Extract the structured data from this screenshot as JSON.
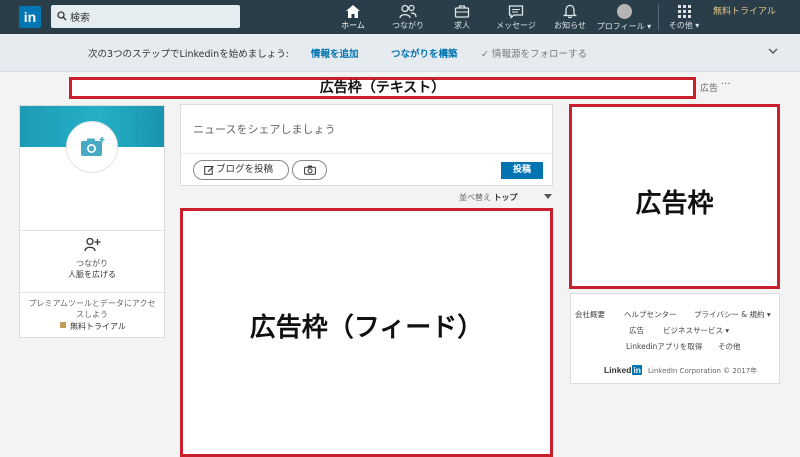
{
  "header": {
    "logo": "in",
    "search_placeholder": "検索",
    "nav": [
      {
        "label": "ホーム",
        "icon": "home-icon"
      },
      {
        "label": "つながり",
        "icon": "people-icon"
      },
      {
        "label": "求人",
        "icon": "briefcase-icon"
      },
      {
        "label": "メッセージ",
        "icon": "chat-icon"
      },
      {
        "label": "お知らせ",
        "icon": "bell-icon"
      },
      {
        "label": "プロフィール ▾",
        "icon": "avatar"
      },
      {
        "label": "その他 ▾",
        "icon": "grid-icon"
      }
    ],
    "premium": "無料トライアル"
  },
  "onboarding": {
    "prompt": "次の3つのステップでLinkedinを始めましょう:",
    "step1": "情報を追加",
    "step2": "つながりを構築",
    "step3": "情報源をフォローする"
  },
  "ads": {
    "text_banner": "広告枠（テキスト）",
    "label": "広告",
    "dots": "···",
    "feed": "広告枠（フィード）",
    "right": "広告枠"
  },
  "profile": {
    "connections_label": "つながり",
    "connections_sub": "人脈を広げる",
    "premium_text": "プレミアムツールとデータにアクセスしよう",
    "premium_link": "無料トライアル"
  },
  "share": {
    "placeholder": "ニュースをシェアしましょう",
    "blog_button": "ブログを投稿",
    "post_button": "投稿"
  },
  "sort": {
    "label": "並べ替え",
    "value": "トップ"
  },
  "footer": {
    "links": [
      "会社概要",
      "ヘルプセンター",
      "プライバシー & 規約 ▾",
      "広告",
      "ビジネスサービス ▾",
      "Linkedinアプリを取得",
      "その他"
    ],
    "logo_text": "Linked",
    "logo_in": "in",
    "copyright": "LinkedIn Corporation © 2017年"
  },
  "colors": {
    "topbar": "#293e49",
    "accent": "#0073b1",
    "ad_border": "#c8202d"
  }
}
